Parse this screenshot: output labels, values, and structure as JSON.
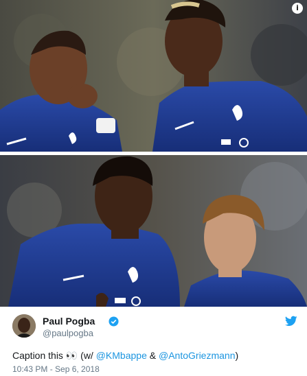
{
  "tweet": {
    "author_name": "Paul Pogba",
    "handle": "@paulpogba",
    "text_prefix": "Caption this ",
    "emoji": "👀",
    "text_w": " (w/ ",
    "mention_1": "@KMbappe",
    "text_and": " & ",
    "mention_2": "@AntoGriezmann",
    "text_close": ")",
    "timestamp": "10:43 PM - Sep 6, 2018"
  },
  "media": {
    "info_glyph": "i",
    "photo_top_icon": "photo",
    "photo_bottom_icon": "photo"
  },
  "colors": {
    "jersey_blue": "#1f3b8f",
    "link_blue": "#1b95e0",
    "twitter_blue": "#1da1f2",
    "verified_blue": "#1da1f2"
  }
}
